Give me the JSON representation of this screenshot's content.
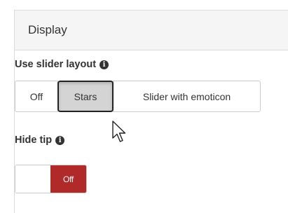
{
  "panel": {
    "title": "Display"
  },
  "slider_layout": {
    "label": "Use slider layout",
    "info_icon": "info-circle-icon",
    "options": [
      {
        "label": "Off"
      },
      {
        "label": "Stars"
      },
      {
        "label": "Slider with emoticon"
      }
    ],
    "selected": "Stars"
  },
  "hide_tip": {
    "label": "Hide tip",
    "info_icon": "info-circle-icon",
    "toggle_label": "Off",
    "toggle_color": "#b12a2a"
  },
  "cursor": "arrow-pointer-icon"
}
